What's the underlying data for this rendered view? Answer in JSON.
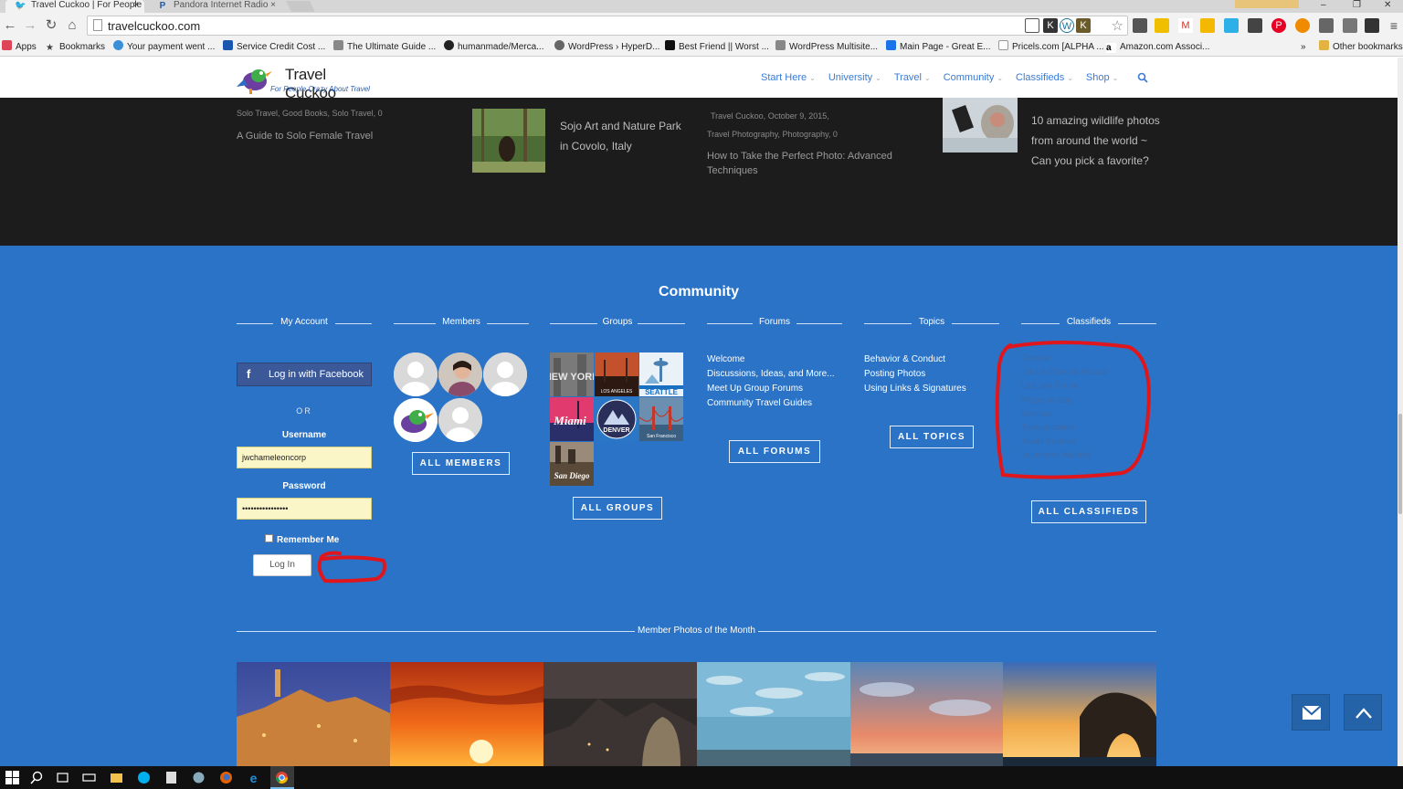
{
  "browser": {
    "tabs": [
      {
        "title": "Travel Cuckoo | For People"
      },
      {
        "title": "Pandora Internet Radio"
      }
    ],
    "url": "travelcuckoo.com",
    "bookmarks": [
      "Apps",
      "Bookmarks",
      "Your payment went ...",
      "Service Credit Cost ...",
      "The Ultimate Guide ...",
      "humanmade/Merca...",
      "WordPress › HyperD...",
      "Best Friend || Worst ...",
      "WordPress Multisite...",
      "Main Page - Great E...",
      "Pricels.com [ALPHA ...",
      "Amazon.com Associ..."
    ],
    "more_bookmarks": "»",
    "other_bookmarks": "Other bookmarks",
    "tab_close": "×",
    "win_min": "–",
    "win_max": "❐",
    "win_close": "✕"
  },
  "site": {
    "title": "Travel Cuckoo",
    "tagline": "For People Crazy About Travel",
    "nav": [
      "Start Here",
      "University",
      "Travel",
      "Community",
      "Classifieds",
      "Shop"
    ]
  },
  "recent": {
    "col1_meta": "Solo Travel, Good Books, Solo Travel, 0",
    "col1_title": "A Guide to Solo Female Travel",
    "col2_title": "Sojo Art and Nature Park in Covolo, Italy",
    "col3_meta1": "Travel Cuckoo, October 9, 2015,",
    "col3_meta2": "Travel Photography, Photography, 0",
    "col3_title": "How to Take the Perfect Photo: Advanced Techniques",
    "col4_title": "10 amazing wildlife photos from around the world ~ Can you pick a favorite?"
  },
  "community": {
    "title": "Community",
    "columns": [
      "My Account",
      "Members",
      "Groups",
      "Forums",
      "Topics",
      "Classifieds"
    ],
    "account": {
      "facebook_label": "Log in with Facebook",
      "or": "OR",
      "username_label": "Username",
      "username_value": "jwchameleoncorp",
      "password_label": "Password",
      "password_value": "••••••••••••••••",
      "remember": "Remember Me",
      "login": "Log In"
    },
    "all_members": "ALL MEMBERS",
    "groups": [
      "NEW YORK",
      "LOS ANGELES",
      "SEATTLE",
      "Miami",
      "DENVER",
      "San Francisco",
      "San Diego"
    ],
    "all_groups": "ALL GROUPS",
    "forums": [
      "Welcome",
      "Discussions, Ideas, and More...",
      "Meet Up Group Forums",
      "Community Travel Guides"
    ],
    "all_forums": "ALL FORUMS",
    "topics": [
      "Behavior & Conduct",
      "Posting Photos",
      "Using Links & Signatures"
    ],
    "all_topics": "ALL TOPICS",
    "classifieds": [
      "General",
      "Jobs & Working Abroad",
      "Lost and Found",
      "Places to stay",
      "Services",
      "Transportation",
      "Travel Buddies",
      "Volunteers Wanted"
    ],
    "all_classifieds": "ALL CLASSIFIEDS",
    "photos_heading": "Member Photos of the Month"
  },
  "colors": {
    "community_bg": "#2a73c6",
    "dark_bg": "#1c1c1c",
    "nav_link": "#3a7bd5",
    "annotation": "#e0161d"
  }
}
